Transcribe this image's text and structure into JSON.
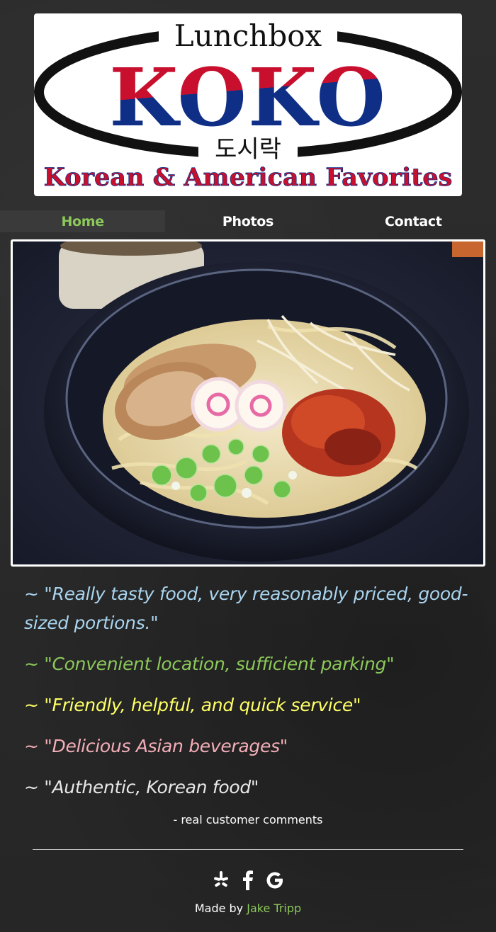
{
  "logo": {
    "top_text": "Lunchbox",
    "brand": "KOKO",
    "korean_text": "도시락",
    "tagline": "Korean & American Favorites",
    "colors": {
      "red": "#c8102e",
      "blue": "#0f2f87",
      "black": "#111111"
    }
  },
  "nav": {
    "items": [
      {
        "label": "Home",
        "active": true
      },
      {
        "label": "Photos",
        "active": false
      },
      {
        "label": "Contact",
        "active": false
      }
    ],
    "active_color": "#8cc85a"
  },
  "hero": {
    "subject": "ramen bowl with pork, narutomaki, kimchi and green onion"
  },
  "quotes": [
    {
      "text": "~ \"Really tasty food, very reasonably priced, good-sized portions.\"",
      "color": "#a9d4ee"
    },
    {
      "text": "~ \"Convenient location, sufficient parking\"",
      "color": "#8cc85a"
    },
    {
      "text": "~ \"Friendly, helpful, and quick service\"",
      "color": "#ffff66"
    },
    {
      "text": "~ \"Delicious Asian beverages\"",
      "color": "#f4aeb8"
    },
    {
      "text": "~ \"Authentic, Korean food\"",
      "color": "#e8e8e8"
    }
  ],
  "credit": "- real customer comments",
  "social": {
    "icons": [
      "yelp-icon",
      "facebook-icon",
      "google-icon"
    ]
  },
  "footer": {
    "made_by_prefix": "Made by",
    "author": "Jake Tripp"
  }
}
